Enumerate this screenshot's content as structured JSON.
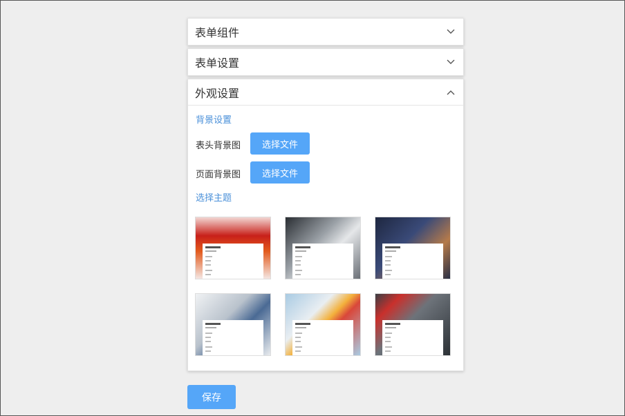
{
  "panels": {
    "components": {
      "title": "表单组件",
      "state": "collapsed"
    },
    "settings": {
      "title": "表单设置",
      "state": "collapsed"
    },
    "appearance": {
      "title": "外观设置",
      "state": "expanded",
      "background_section": "背景设置",
      "header_bg_label": "表头背景图",
      "page_bg_label": "页面背景图",
      "choose_file_label": "选择文件",
      "theme_section": "选择主题",
      "themes": [
        {
          "name": "red-celebration",
          "color": "#c8201a"
        },
        {
          "name": "business-meeting",
          "color": "#7a8088"
        },
        {
          "name": "card-payment",
          "color": "#2c3550"
        },
        {
          "name": "office-documents",
          "color": "#b9c2cc"
        },
        {
          "name": "colored-pencils",
          "color": "#a9cbe3"
        },
        {
          "name": "construction-workers",
          "color": "#555b62"
        }
      ]
    }
  },
  "save_label": "保存",
  "colors": {
    "accent": "#55a6f8",
    "link": "#4a90d9",
    "background": "#eeeeee"
  }
}
